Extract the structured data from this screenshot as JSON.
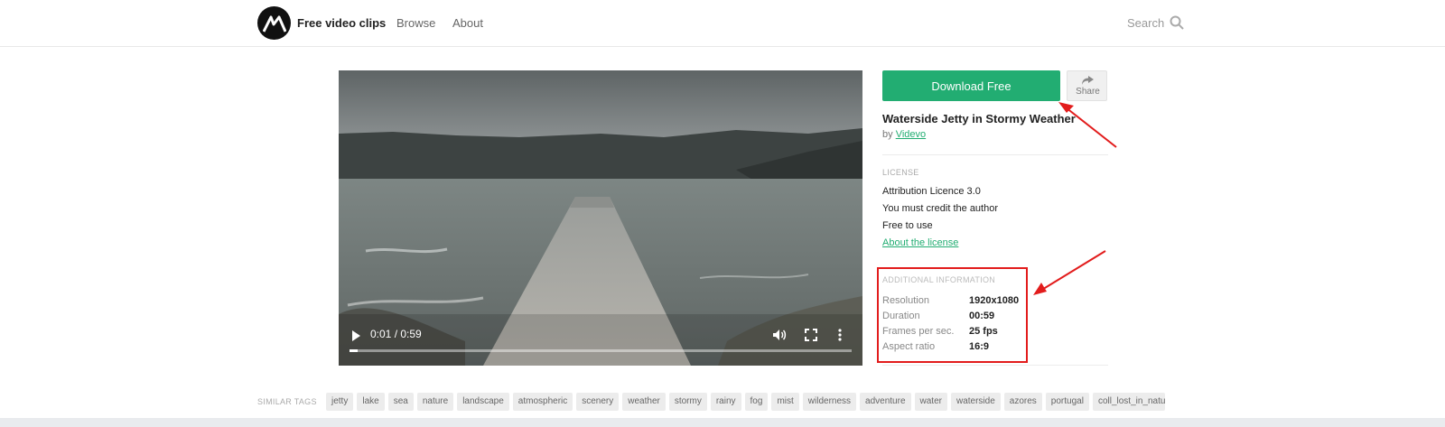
{
  "header": {
    "brand": "Free video clips",
    "nav": {
      "browse": "Browse",
      "about": "About"
    },
    "search_label": "Search"
  },
  "player": {
    "time": "0:01 / 0:59",
    "progress": 0.017
  },
  "actions": {
    "download_label": "Download Free",
    "share_label": "Share"
  },
  "video": {
    "title": "Waterside Jetty in Stormy Weather",
    "by_prefix": "by",
    "author": "Videvo"
  },
  "license": {
    "label": "LICENSE",
    "lines": [
      "Attribution Licence 3.0",
      "You must credit the author",
      "Free to use"
    ],
    "link": "About the license"
  },
  "info": {
    "label": "ADDITIONAL INFORMATION",
    "rows": [
      {
        "key": "Resolution",
        "value": "1920x1080"
      },
      {
        "key": "Duration",
        "value": "00:59"
      },
      {
        "key": "Frames per sec.",
        "value": "25 fps"
      },
      {
        "key": "Aspect ratio",
        "value": "16:9"
      }
    ]
  },
  "tags": {
    "label": "SIMILAR TAGS",
    "items": [
      "jetty",
      "lake",
      "sea",
      "nature",
      "landscape",
      "atmospheric",
      "scenery",
      "weather",
      "stormy",
      "rainy",
      "fog",
      "mist",
      "wilderness",
      "adventure",
      "water",
      "waterside",
      "azores",
      "portugal",
      "coll_lost_in_nature"
    ]
  },
  "colors": {
    "accent": "#22ad72",
    "annotation": "#e21c1c"
  },
  "icons": [
    "logo-icon",
    "search-icon",
    "share-icon",
    "play-icon",
    "volume-icon",
    "fullscreen-icon",
    "more-icon"
  ]
}
